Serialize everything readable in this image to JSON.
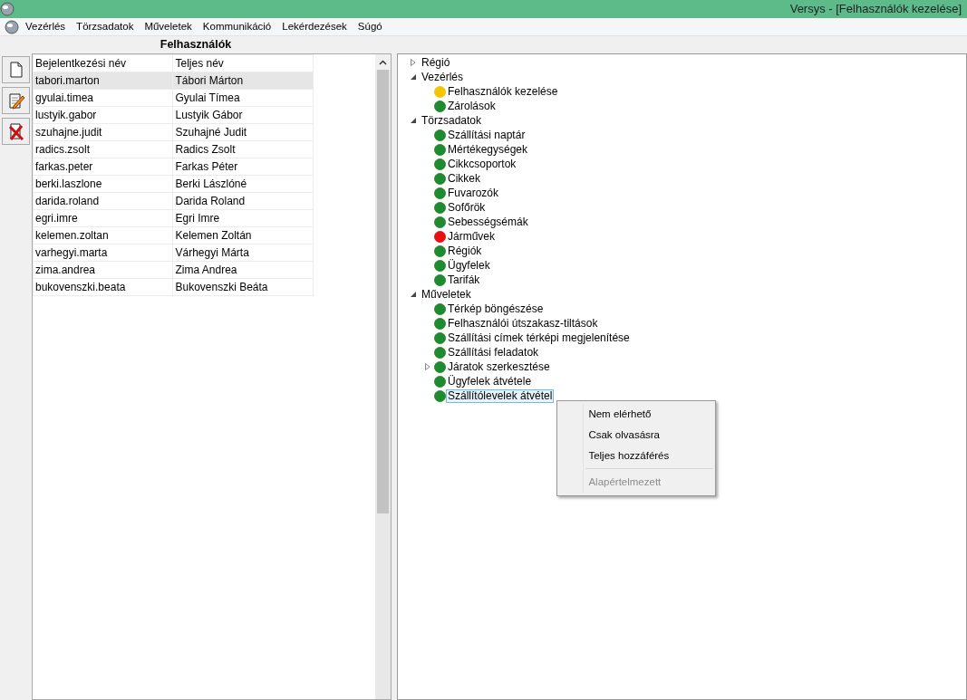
{
  "window": {
    "title": "Versys - [Felhasználók kezelése]"
  },
  "menu": [
    "Vezérlés",
    "Törzsadatok",
    "Műveletek",
    "Kommunikáció",
    "Lekérdezések",
    "Súgó"
  ],
  "panel_title": "Felhasználók",
  "toolbar": [
    {
      "kind": "new"
    },
    {
      "kind": "edit"
    },
    {
      "kind": "delete"
    }
  ],
  "table": {
    "columns": [
      "Bejelentkezési név",
      "Teljes név"
    ],
    "rows": [
      {
        "cells": [
          "tabori.marton",
          "Tábori Márton"
        ],
        "selected": true
      },
      {
        "cells": [
          "gyulai.timea",
          "Gyulai Tímea"
        ],
        "selected": false
      },
      {
        "cells": [
          "lustyik.gabor",
          "Lustyik Gábor"
        ],
        "selected": false
      },
      {
        "cells": [
          "szuhajne.judit",
          "Szuhajné Judit"
        ],
        "selected": false
      },
      {
        "cells": [
          "radics.zsolt",
          "Radics Zsolt"
        ],
        "selected": false
      },
      {
        "cells": [
          "farkas.peter",
          "Farkas Péter"
        ],
        "selected": false
      },
      {
        "cells": [
          "berki.laszlone",
          "Berki Lászlóné"
        ],
        "selected": false
      },
      {
        "cells": [
          "darida.roland",
          "Darida Roland"
        ],
        "selected": false
      },
      {
        "cells": [
          "egri.imre",
          "Egri Imre"
        ],
        "selected": false
      },
      {
        "cells": [
          "kelemen.zoltan",
          "Kelemen Zoltán"
        ],
        "selected": false
      },
      {
        "cells": [
          "varhegyi.marta",
          "Várhegyi Márta"
        ],
        "selected": false
      },
      {
        "cells": [
          "zima.andrea",
          "Zima Andrea"
        ],
        "selected": false
      },
      {
        "cells": [
          "bukovenszki.beata",
          "Bukovenszki Beáta"
        ],
        "selected": false
      }
    ]
  },
  "tree": [
    {
      "label": "Régió",
      "expanded": false
    },
    {
      "label": "Vezérlés",
      "expanded": true,
      "children": [
        {
          "label": "Felhasználók kezelése",
          "color": "#f5c400",
          "selected": false
        },
        {
          "label": "Zárolások",
          "color": "#1f8a2e",
          "selected": false
        }
      ]
    },
    {
      "label": "Törzsadatok",
      "expanded": true,
      "children": [
        {
          "label": "Szállítási naptár",
          "color": "#1f8a2e",
          "selected": false
        },
        {
          "label": "Mértékegységek",
          "color": "#1f8a2e",
          "selected": false
        },
        {
          "label": "Cikkcsoportok",
          "color": "#1f8a2e",
          "selected": false
        },
        {
          "label": "Cikkek",
          "color": "#1f8a2e",
          "selected": false
        },
        {
          "label": "Fuvarozók",
          "color": "#1f8a2e",
          "selected": false
        },
        {
          "label": "Sofőrök",
          "color": "#1f8a2e",
          "selected": false
        },
        {
          "label": "Sebességsémák",
          "color": "#1f8a2e",
          "selected": false
        },
        {
          "label": "Járművek",
          "color": "#e81010",
          "selected": false
        },
        {
          "label": "Régiók",
          "color": "#1f8a2e",
          "selected": false
        },
        {
          "label": "Ügyfelek",
          "color": "#1f8a2e",
          "selected": false
        },
        {
          "label": "Tarifák",
          "color": "#1f8a2e",
          "selected": false
        }
      ]
    },
    {
      "label": "Műveletek",
      "expanded": true,
      "children": [
        {
          "label": "Térkép böngészése",
          "color": "#1f8a2e",
          "selected": false
        },
        {
          "label": "Felhasználói útszakasz-tiltások",
          "color": "#1f8a2e",
          "selected": false
        },
        {
          "label": "Szállítási címek térképi megjelenítése",
          "color": "#1f8a2e",
          "selected": false
        },
        {
          "label": "Szállítási feladatok",
          "color": "#1f8a2e",
          "selected": false
        },
        {
          "label": "Járatok szerkesztése",
          "color": "#1f8a2e",
          "selected": false,
          "expanded": false
        },
        {
          "label": "Ügyfelek átvétele",
          "color": "#1f8a2e",
          "selected": false
        },
        {
          "label": "Szállítólevelek átvétel",
          "color": "#1f8a2e",
          "selected": true
        }
      ]
    }
  ],
  "context_menu": [
    {
      "kind": "item",
      "label": "Nem elérhető",
      "disabled": false
    },
    {
      "kind": "item",
      "label": "Csak olvasásra",
      "disabled": false
    },
    {
      "kind": "item",
      "label": "Teljes hozzáférés",
      "disabled": false
    },
    {
      "kind": "separator"
    },
    {
      "kind": "item",
      "label": "Alapértelmezett",
      "disabled": true
    }
  ]
}
